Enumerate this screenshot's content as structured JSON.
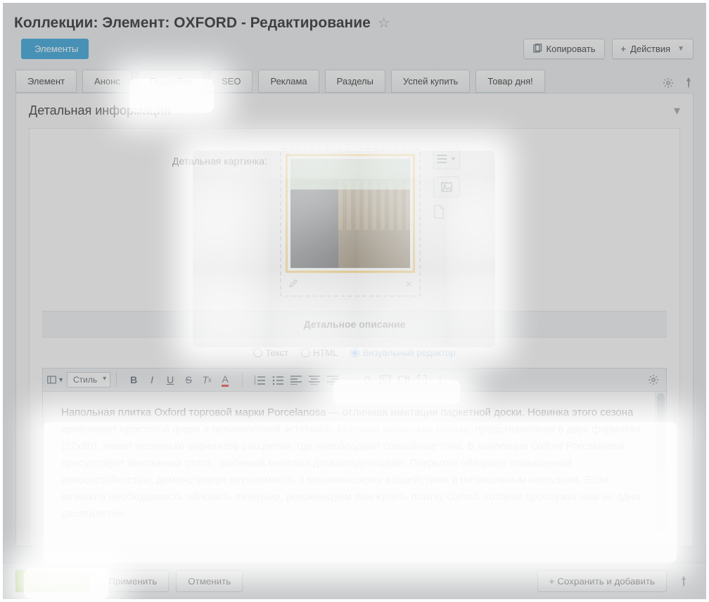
{
  "page_title": "Коллекции: Элемент: OXFORD - Редактирование",
  "breadcrumb_back": "Элементы",
  "top_buttons": {
    "copy": "Копировать",
    "actions": "Действия"
  },
  "tabs": [
    {
      "label": "Элемент",
      "active": false
    },
    {
      "label": "Анонс",
      "active": false
    },
    {
      "label": "Подробно",
      "active": true
    },
    {
      "label": "SEO",
      "active": false
    },
    {
      "label": "Реклама",
      "active": false
    },
    {
      "label": "Разделы",
      "active": false
    },
    {
      "label": "Успей купить",
      "active": false
    },
    {
      "label": "Товар дня!",
      "active": false
    }
  ],
  "section_title": "Детальная информация",
  "detail_image_label": "Детальная картинка:",
  "description_header": "Детальное описание",
  "editor_modes": {
    "text": "Текст",
    "html": "HTML",
    "visual": "Визуальный редактор",
    "selected": "visual"
  },
  "style_select_label": "Стиль",
  "editor_content": "Напольная плитка Oxford торговой марки Porcelanosa — отличная имитация паркетной доски. Новинка этого сезона привлекает простотой форм и великолепной эстетикой. Матовая испанская плитка, представленная в двух форматах (22х90), имеет несколько вариантов расцветки, где преобладают спокойные тона. В коллекции Oxford Porcelanosa присутствует винтажный стиль, любимый многими домовладельцами. Покрытие обладает повышенной износостойкостью, демонстрируя неуязвимость к механическому воздействию и интенсивным нагрузкам. Если возникла необходимость обновить интерьер, рекомендуем вам купить плитку Oxford, которая прослужит вам не одно десятилетие.",
  "bottom_buttons": {
    "save": "Сохранить",
    "apply": "Применить",
    "cancel": "Отменить",
    "save_and_add": "Сохранить и добавить"
  }
}
